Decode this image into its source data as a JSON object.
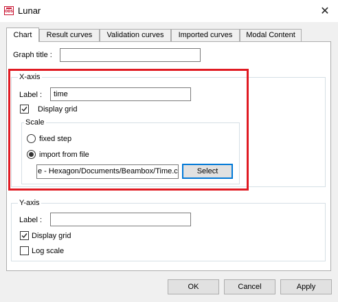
{
  "window": {
    "title": "Lunar",
    "icon_name": "ods-app-icon",
    "icon_text": "ODS",
    "close_glyph": "✕"
  },
  "tabs": [
    {
      "label": "Chart",
      "active": true
    },
    {
      "label": "Result curves",
      "active": false
    },
    {
      "label": "Validation curves",
      "active": false
    },
    {
      "label": "Imported curves",
      "active": false
    },
    {
      "label": "Modal Content",
      "active": false
    }
  ],
  "graph": {
    "title_label": "Graph title :",
    "title_value": ""
  },
  "x_axis": {
    "group_title": "X-axis",
    "label_caption": "Label :",
    "label_value": "time",
    "display_grid_label": "Display grid",
    "display_grid_checked": true,
    "scale": {
      "group_title": "Scale",
      "fixed_step_label": "fixed step",
      "import_label": "import from file",
      "selected": "import from file",
      "file_path": "e - Hexagon/Documents/Beambox/Time.csv",
      "select_label": "Select"
    }
  },
  "y_axis": {
    "group_title": "Y-axis",
    "label_caption": "Label :",
    "label_value": "",
    "display_grid_label": "Display grid",
    "display_grid_checked": true,
    "log_scale_label": "Log scale",
    "log_scale_checked": false
  },
  "footer": {
    "ok_label": "OK",
    "cancel_label": "Cancel",
    "apply_label": "Apply"
  },
  "colors": {
    "highlight": "#e01a22",
    "focus": "#0078d7"
  }
}
